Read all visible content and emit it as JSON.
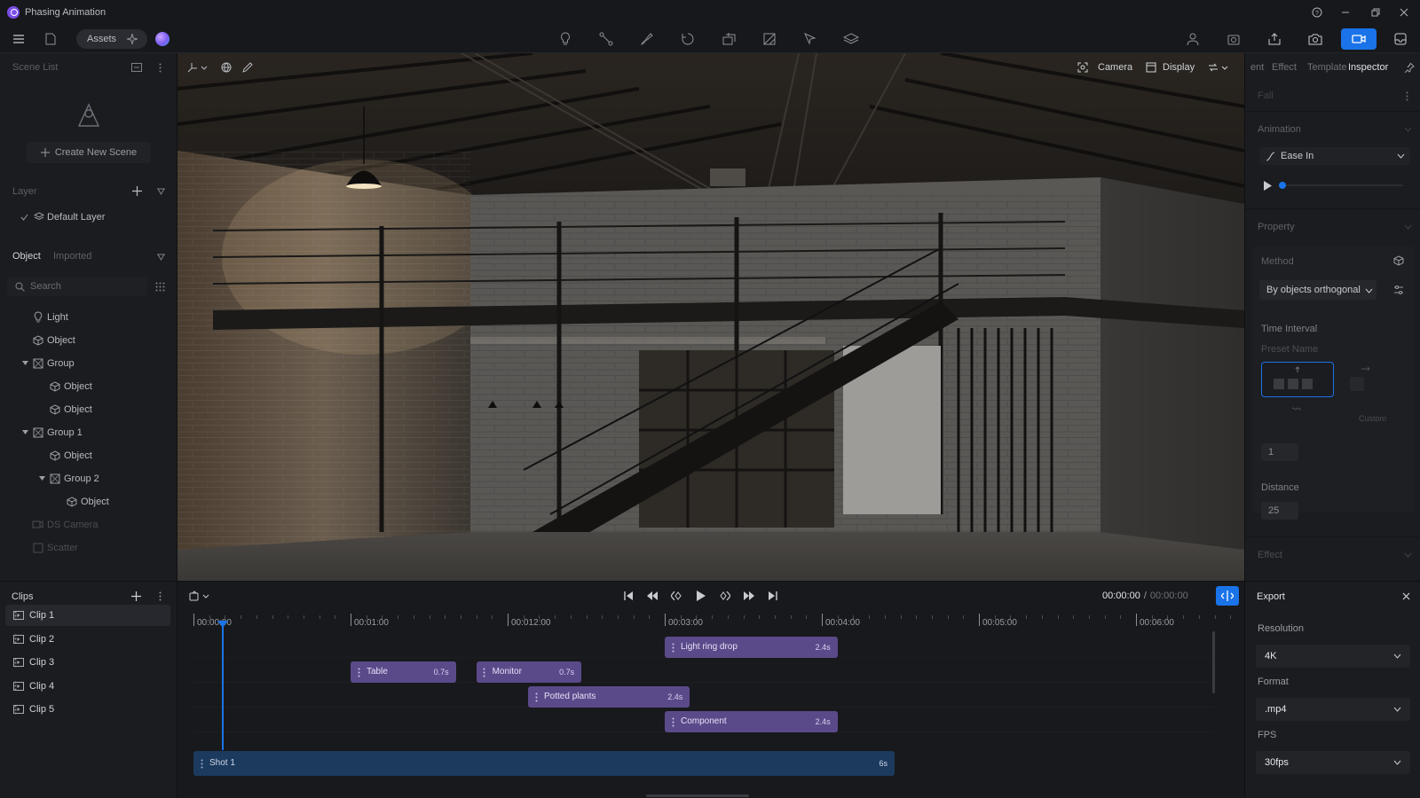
{
  "window": {
    "title": "Phasing Animation"
  },
  "toolbar": {
    "assets_label": "Assets"
  },
  "left_panel": {
    "scene_list_title": "Scene List",
    "create_scene_label": "Create New Scene",
    "layer_title": "Layer",
    "default_layer": "Default Layer",
    "tabs": {
      "object": "Object",
      "imported": "Imported"
    },
    "search_placeholder": "Search",
    "tree": [
      {
        "label": "Light",
        "indent": 0,
        "icon": "light-bulb-icon"
      },
      {
        "label": "Object",
        "indent": 0,
        "icon": "cube-icon"
      },
      {
        "label": "Group",
        "indent": 0,
        "icon": "group-icon",
        "expanded": true
      },
      {
        "label": "Object",
        "indent": 1,
        "icon": "cube-icon"
      },
      {
        "label": "Object",
        "indent": 1,
        "icon": "cube-icon"
      },
      {
        "label": "Group 1",
        "indent": 0,
        "icon": "group-icon",
        "expanded": true
      },
      {
        "label": "Object",
        "indent": 1,
        "icon": "cube-icon"
      },
      {
        "label": "Group 2",
        "indent": 1,
        "icon": "group-icon",
        "expanded": true
      },
      {
        "label": "Object",
        "indent": 2,
        "icon": "cube-icon"
      },
      {
        "label": "DS Camera",
        "indent": 0,
        "icon": "camera-icon",
        "dim": true
      },
      {
        "label": "Scatter",
        "indent": 0,
        "icon": "scatter-icon",
        "dim": true
      }
    ]
  },
  "viewport": {
    "camera_label": "Camera",
    "display_label": "Display"
  },
  "right_panel": {
    "tabs": [
      "ent",
      "Effect",
      "Template",
      "Inspector"
    ],
    "active_tab": "Inspector",
    "fall_label": "Fall",
    "animation_title": "Animation",
    "easing_value": "Ease In",
    "progress": 0.0,
    "property_title": "Property",
    "method_label": "Method",
    "method_value": "By objects orthogonal",
    "time_interval_label": "Time Interval",
    "preset_name_label": "Preset Name",
    "custom_label": "Custom",
    "interval_value": "1",
    "distance_label": "Distance",
    "distance_value": "25",
    "effect_title": "Effect"
  },
  "clips": {
    "title": "Clips",
    "items": [
      "Clip 1",
      "Clip 2",
      "Clip 3",
      "Clip 4",
      "Clip 5"
    ],
    "selected": 0
  },
  "timeline": {
    "current_time": "00:00:00",
    "total_time": "00:00:00",
    "ruler": [
      "00:00:00",
      "00:01:00",
      "00:012:00",
      "00:03:00",
      "00:04:00",
      "00:05:00",
      "00:06:00"
    ],
    "tracks": [
      {
        "name": "Light ring drop",
        "duration": "2.4s",
        "start": 3.0,
        "length": 1.1,
        "row": 0
      },
      {
        "name": "Table",
        "duration": "0.7s",
        "start": 1.0,
        "length": 0.67,
        "row": 1
      },
      {
        "name": "Monitor",
        "duration": "0.7s",
        "start": 1.8,
        "length": 0.67,
        "row": 1
      },
      {
        "name": "Potted plants",
        "duration": "2.4s",
        "start": 2.13,
        "length": 1.03,
        "row": 2
      },
      {
        "name": "Component",
        "duration": "2.4s",
        "start": 3.0,
        "length": 1.1,
        "row": 3
      }
    ],
    "shot": {
      "name": "Shot 1",
      "duration": "6s"
    }
  },
  "export": {
    "title": "Export",
    "resolution_label": "Resolution",
    "resolution_value": "4K",
    "format_label": "Format",
    "format_value": ".mp4",
    "fps_label": "FPS",
    "fps_value": "30fps"
  },
  "colors": {
    "accent": "#1a73e8",
    "clip": "#5b4a8a",
    "shot": "#1c3a5e",
    "panel": "#1b1c20"
  }
}
